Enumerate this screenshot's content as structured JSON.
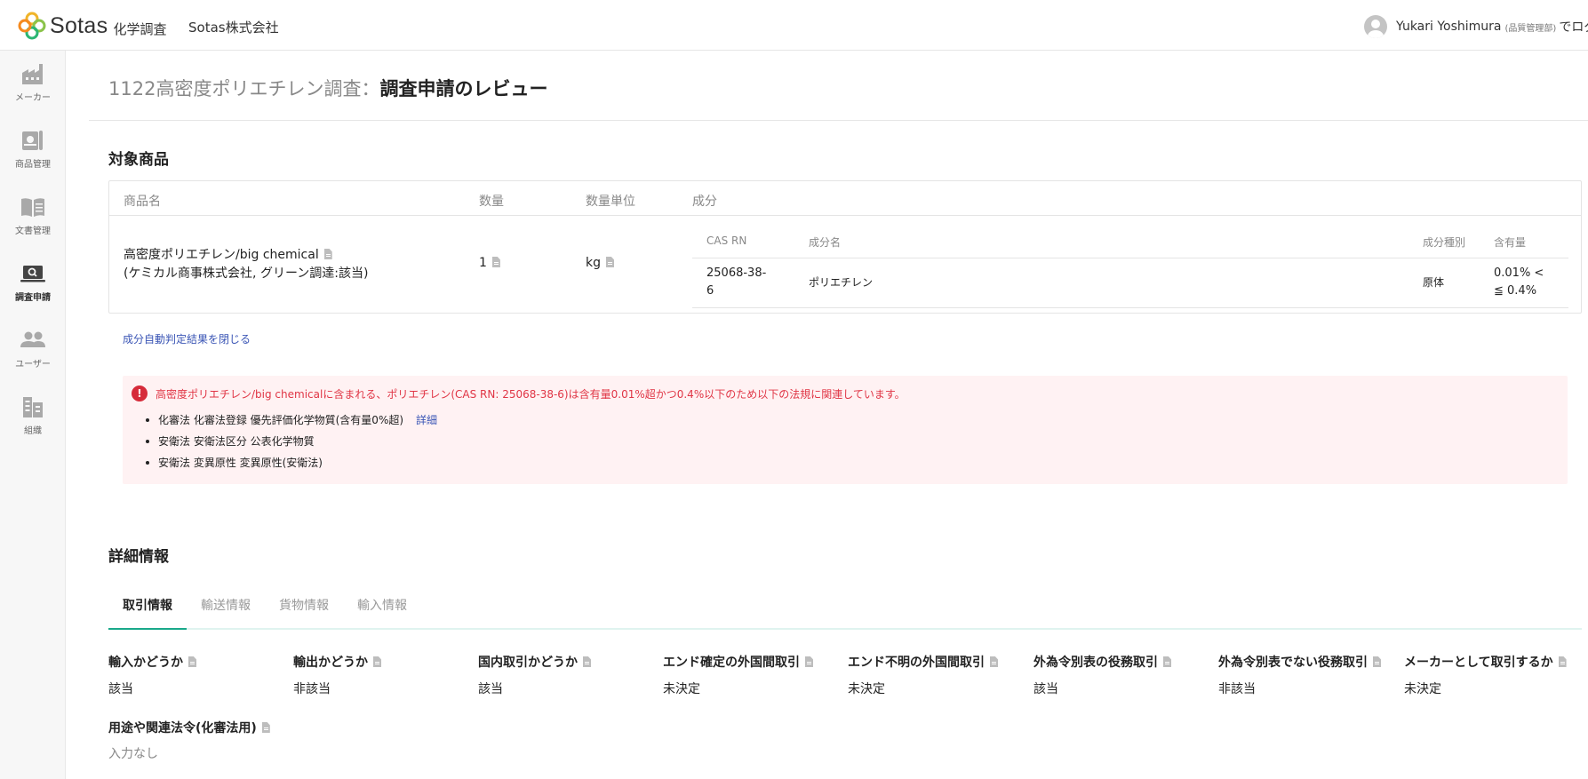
{
  "header": {
    "logo_text": "Sotas",
    "logo_sub": "化学調査",
    "company": "Sotas株式会社",
    "user_name": "Yukari Yoshimura",
    "user_dept": "(品質管理部)",
    "user_suffix": "でログ"
  },
  "sidebar": {
    "items": [
      {
        "label": "メーカー",
        "icon": "factory-icon"
      },
      {
        "label": "商品管理",
        "icon": "box-icon"
      },
      {
        "label": "文書管理",
        "icon": "book-icon"
      },
      {
        "label": "調査申請",
        "icon": "laptop-search-icon"
      },
      {
        "label": "ユーザー",
        "icon": "users-icon"
      },
      {
        "label": "組織",
        "icon": "building-icon"
      }
    ]
  },
  "page": {
    "title_prefix": "1122高密度ポリエチレン調査：",
    "title_main": "調査申請のレビュー"
  },
  "products": {
    "section_title": "対象商品",
    "columns": [
      "商品名",
      "数量",
      "数量単位",
      "成分"
    ],
    "row": {
      "name_line1": "高密度ポリエチレン/big chemical",
      "name_line2": "(ケミカル商事株式会社, グリーン調達:該当)",
      "quantity": "1",
      "unit": "kg"
    },
    "component_columns": [
      "CAS RN",
      "成分名",
      "成分種別",
      "含有量"
    ],
    "component": {
      "cas_line1": "25068-38-",
      "cas_line2": "6",
      "name": "ポリエチレン",
      "type": "原体",
      "content_line1": "0.01% <",
      "content_line2": "≦ 0.4%"
    }
  },
  "auto_judge": {
    "close_link": "成分自動判定結果を閉じる",
    "alert_icon": "!",
    "message": "高密度ポリエチレン/big chemicalに含まれる、ポリエチレン(CAS RN: 25068-38-6)は含有量0.01%超かつ0.4%以下のため以下の法規に関連しています。",
    "items": [
      "化審法 化審法登録 優先評価化学物質(含有量0%超)",
      "安衛法 安衛法区分 公表化学物質",
      "安衛法 変異原性 変異原性(安衛法)"
    ],
    "detail_link": "詳細"
  },
  "details": {
    "section_title": "詳細情報",
    "tabs": [
      "取引情報",
      "輸送情報",
      "貨物情報",
      "輸入情報"
    ],
    "active_tab": 0,
    "fields": [
      {
        "label": "輸入かどうか",
        "value": "該当"
      },
      {
        "label": "輸出かどうか",
        "value": "非該当"
      },
      {
        "label": "国内取引かどうか",
        "value": "該当"
      },
      {
        "label": "エンド確定の外国間取引",
        "value": "未決定"
      },
      {
        "label": "エンド不明の外国間取引",
        "value": "未決定"
      },
      {
        "label": "外為令別表の役務取引",
        "value": "該当"
      },
      {
        "label": "外為令別表でない役務取引",
        "value": "非該当"
      },
      {
        "label": "メーカーとして取引するか",
        "value": "未決定"
      }
    ],
    "extra_field": {
      "label": "用途や関連法令(化審法用)",
      "value": "入力なし"
    }
  },
  "colors": {
    "accent": "#19a98a",
    "alert_bg": "#fff2f3",
    "alert_text": "#e03545",
    "link": "#3a55b5"
  }
}
